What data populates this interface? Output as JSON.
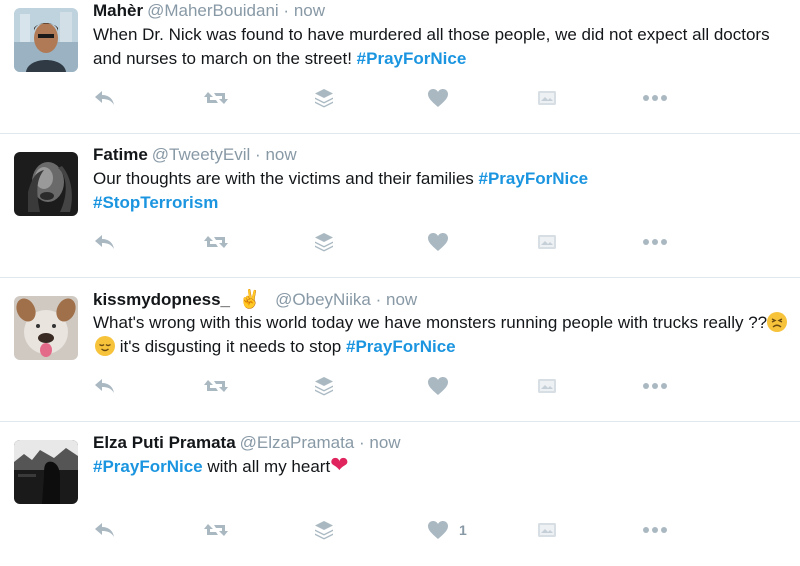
{
  "tweets": [
    {
      "name": "Mahèr",
      "handle": "@MaherBouidani",
      "dot": "·",
      "time": "now",
      "text_plain": "When Dr. Nick was found to have murdered all those people, we did not expect all doctors and nurses to march on the street! ",
      "hashtag_a": "#PrayForNice",
      "like_count": ""
    },
    {
      "name": "Fatime",
      "handle": "@TweetyEvil",
      "dot": "·",
      "time": "now",
      "text_plain": "Our thoughts are with the victims and their families ",
      "hashtag_a": "#PrayForNice",
      "hashtag_b": "#StopTerrorism",
      "like_count": ""
    },
    {
      "name": "kissmydopness_",
      "name_emoji": "✌",
      "handle": "@ObeyNiika",
      "dot": "·",
      "time": "now",
      "text_plain": "What's wrong with this world today we have monsters running people with trucks really ??",
      "text_plain_2": " it's disgusting it needs to stop ",
      "hashtag_a": "#PrayForNice",
      "like_count": ""
    },
    {
      "name": "Elza Puti Pramata",
      "handle": "@ElzaPramata",
      "dot": "·",
      "time": "now",
      "hashtag_a": "#PrayForNice",
      "text_plain": " with all my heart",
      "text_emoji": "❤",
      "like_count": "1"
    }
  ],
  "icons": [
    "reply-icon",
    "retweet-icon",
    "layers-icon",
    "heart-icon",
    "media-icon",
    "more-icon"
  ],
  "colors": {
    "hashtag": "#1b95e0",
    "muted": "#8899a6",
    "icon": "#aab8c2",
    "divider": "#e1e8ed",
    "heart_red": "#e0245e"
  }
}
